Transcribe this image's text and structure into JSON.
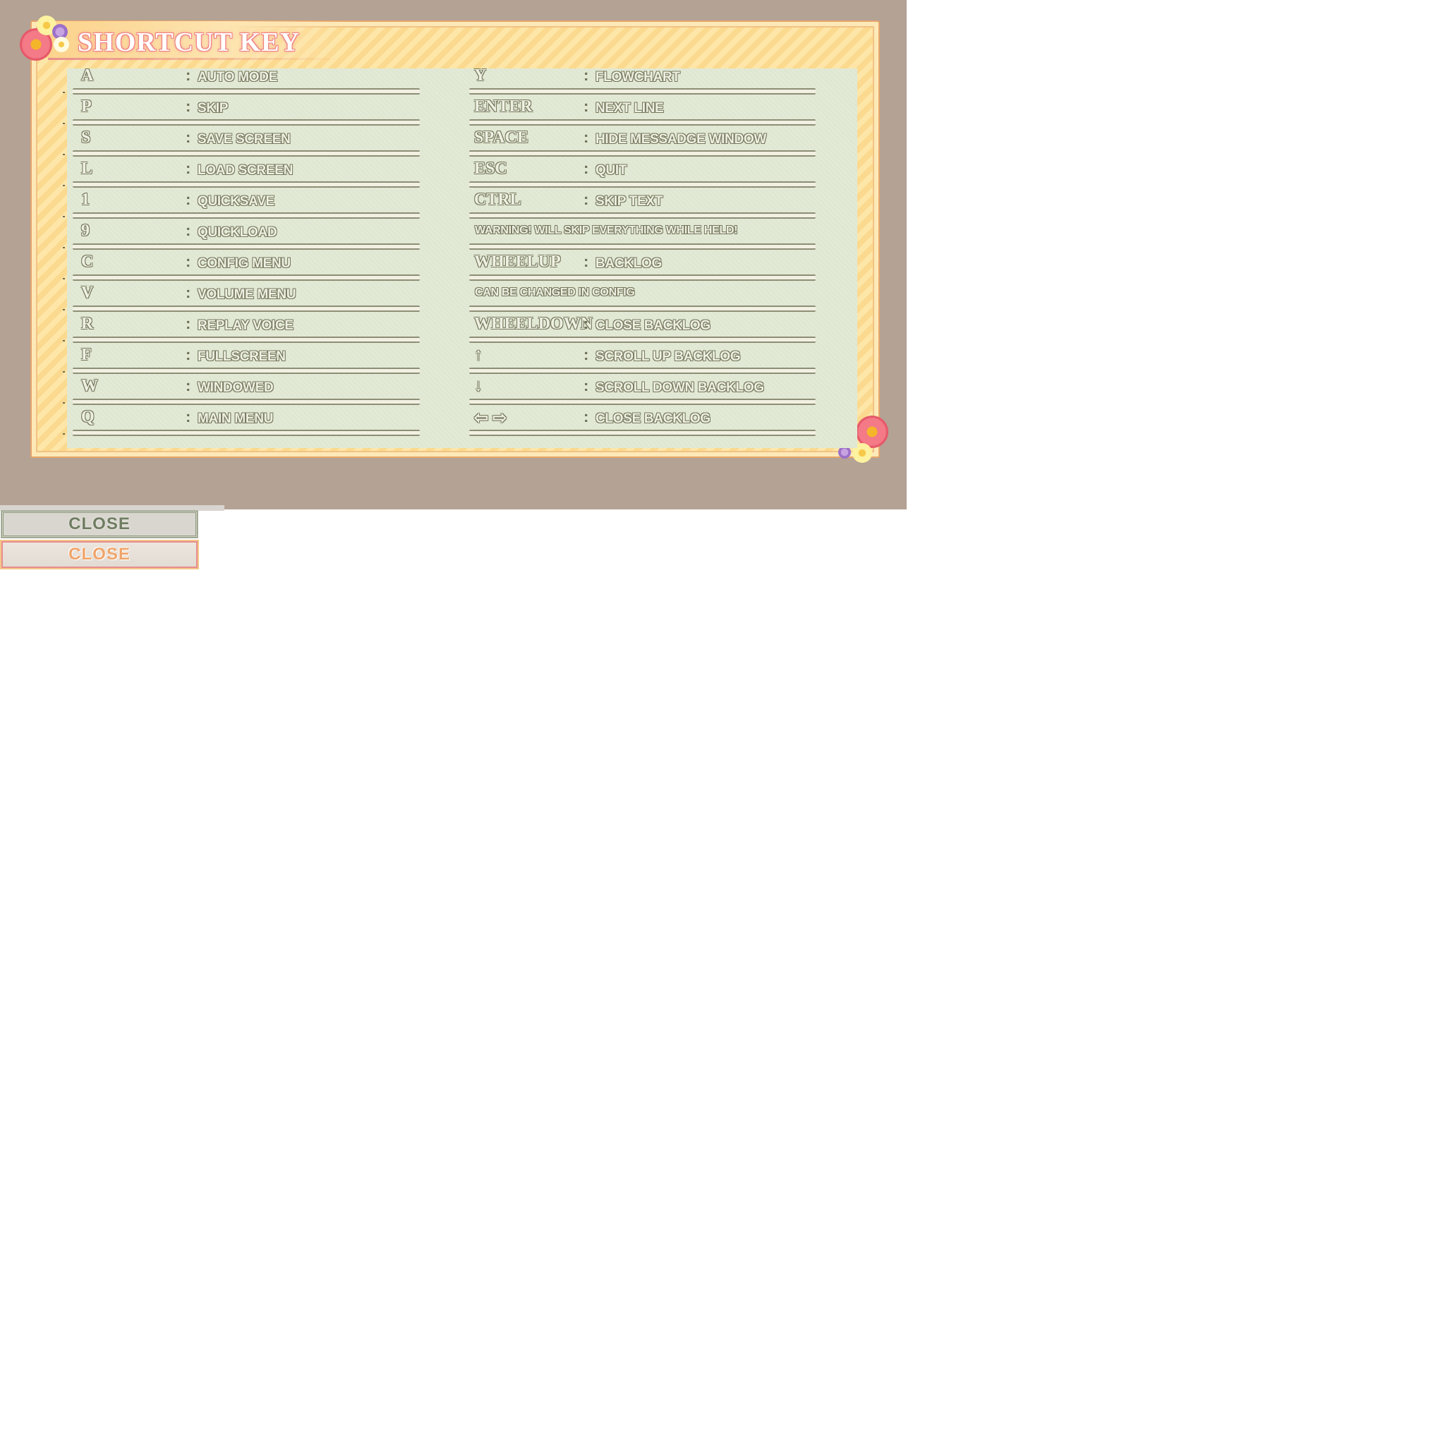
{
  "title": "SHORTCUT KEY",
  "separator": ":",
  "left_column": [
    {
      "key": "A",
      "action": "AUTO MODE"
    },
    {
      "key": "P",
      "action": "SKIP"
    },
    {
      "key": "S",
      "action": "SAVE SCREEN"
    },
    {
      "key": "L",
      "action": "LOAD SCREEN"
    },
    {
      "key": "1",
      "action": "QUICKSAVE"
    },
    {
      "key": "9",
      "action": "QUICKLOAD"
    },
    {
      "key": "C",
      "action": "CONFIG MENU"
    },
    {
      "key": "V",
      "action": "VOLUME MENU"
    },
    {
      "key": "R",
      "action": "REPLAY VOICE"
    },
    {
      "key": "F",
      "action": "FULLSCREEN"
    },
    {
      "key": "W",
      "action": "WINDOWED"
    },
    {
      "key": "Q",
      "action": "MAIN MENU"
    }
  ],
  "right_column": [
    {
      "key": "Y",
      "action": "FLOWCHART"
    },
    {
      "key": "ENTER",
      "action": "NEXT LINE"
    },
    {
      "key": "SPACE",
      "action": "HIDE MESSADGE WINDOW"
    },
    {
      "key": "ESC",
      "action": "QUIT"
    },
    {
      "key": "CTRL",
      "action": "SKIP TEXT"
    },
    {
      "note": "WARNING! WILL SKIP EVERYTHING WHILE HELD!"
    },
    {
      "key": "WHEELUP",
      "action": "BACKLOG"
    },
    {
      "note": "CAN BE CHANGED IN CONFIG"
    },
    {
      "key": "WHEELDOWN",
      "action": "CLOSE BACKLOG"
    },
    {
      "key": "↑",
      "action": "SCROLL UP BACKLOG"
    },
    {
      "key": "↓",
      "action": "SCROLL DOWN BACKLOG"
    },
    {
      "key": "⇦ ⇨",
      "action": "CLOSE BACKLOG"
    }
  ],
  "buttons": {
    "close_normal": "CLOSE",
    "close_hover": "CLOSE"
  },
  "colors": {
    "background": "#b4a295",
    "frame": "#fbd98e",
    "panel": "#dfe7d2",
    "text_outline": "#76775d",
    "title_outline": "#ef7f7f"
  }
}
